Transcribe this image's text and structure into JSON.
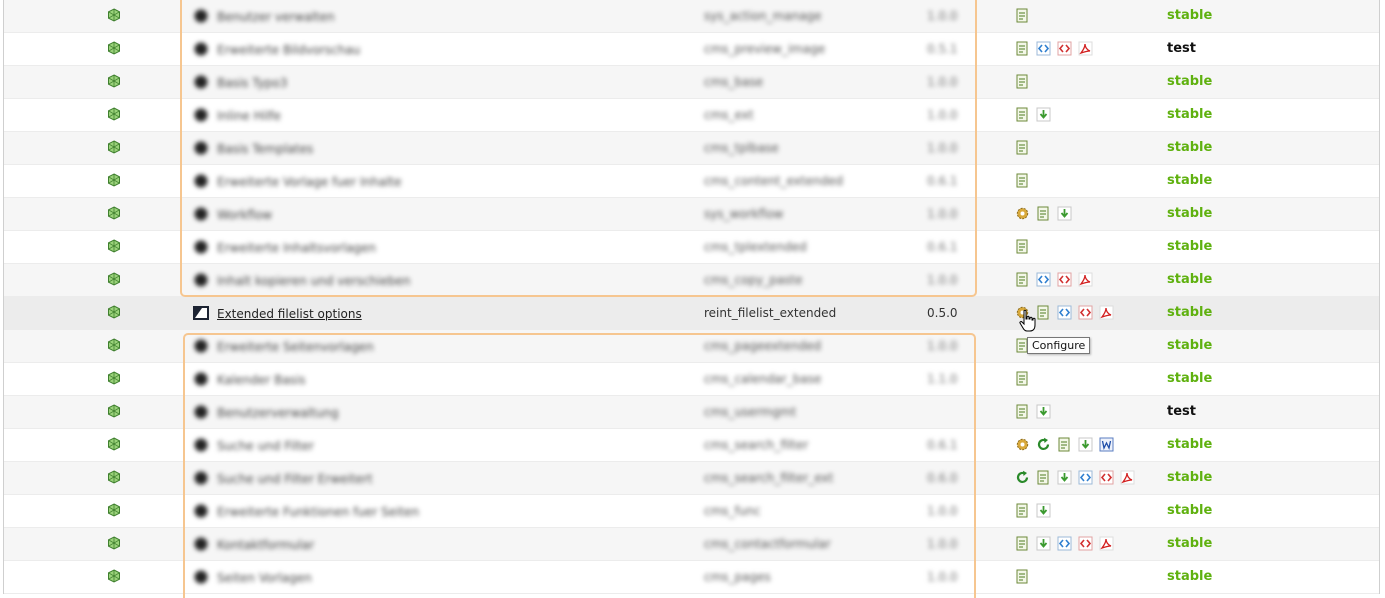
{
  "colors": {
    "stable": "#5fb10f",
    "test": "#111111",
    "highlight_border": "#f6c690"
  },
  "rows": [
    {
      "title": "Benutzer verwalten",
      "key": "sys_action_manage",
      "version": "1.0.0",
      "state": "stable",
      "state_class": "stable",
      "actions": [
        "doc-icon"
      ],
      "blurred": true
    },
    {
      "title": "Erweiterte Bildvorschau",
      "key": "cms_preview_image",
      "version": "0.5.1",
      "state": "test",
      "state_class": "test",
      "actions": [
        "doc-icon",
        "code-blue-icon",
        "code-red-icon",
        "pdf-icon"
      ],
      "blurred": true
    },
    {
      "title": "Basis Typo3",
      "key": "cms_base",
      "version": "1.0.0",
      "state": "stable",
      "state_class": "stable",
      "actions": [
        "doc-icon"
      ],
      "blurred": true
    },
    {
      "title": "Inline Hilfe",
      "key": "cms_ext",
      "version": "1.0.0",
      "state": "stable",
      "state_class": "stable",
      "actions": [
        "doc-icon",
        "download-icon"
      ],
      "blurred": true
    },
    {
      "title": "Basis Templates",
      "key": "cms_tplbase",
      "version": "1.0.0",
      "state": "stable",
      "state_class": "stable",
      "actions": [
        "doc-icon"
      ],
      "blurred": true
    },
    {
      "title": "Erweiterte Vorlage fuer Inhalte",
      "key": "cms_content_extended",
      "version": "0.6.1",
      "state": "stable",
      "state_class": "stable",
      "actions": [
        "doc-icon"
      ],
      "blurred": true
    },
    {
      "title": "Workflow",
      "key": "sys_workflow",
      "version": "1.0.0",
      "state": "stable",
      "state_class": "stable",
      "actions": [
        "gear-icon",
        "doc-icon",
        "download-icon"
      ],
      "blurred": true
    },
    {
      "title": "Erweiterte Inhaltsvorlagen",
      "key": "cms_tplextended",
      "version": "0.6.1",
      "state": "stable",
      "state_class": "stable",
      "actions": [
        "doc-icon"
      ],
      "blurred": true
    },
    {
      "title": "Inhalt kopieren und verschieben",
      "key": "cms_copy_paste",
      "version": "1.0.0",
      "state": "stable",
      "state_class": "stable",
      "actions": [
        "doc-icon",
        "code-blue-icon",
        "code-red-icon",
        "pdf-icon"
      ],
      "blurred": true
    },
    {
      "title": "Extended filelist options",
      "key": "reint_filelist_extended",
      "version": "0.5.0",
      "state": "stable",
      "state_class": "stable",
      "actions": [
        "gear-icon",
        "doc-icon",
        "code-blue-icon",
        "code-red-icon",
        "pdf-icon"
      ],
      "blurred": false,
      "active": true
    },
    {
      "title": "Erweiterte Seitenvorlagen",
      "key": "cms_pageextended",
      "version": "1.0.0",
      "state": "stable",
      "state_class": "stable",
      "actions": [
        "doc-icon"
      ],
      "blurred": true
    },
    {
      "title": "Kalender Basis",
      "key": "cms_calendar_base",
      "version": "1.1.0",
      "state": "stable",
      "state_class": "stable",
      "actions": [
        "doc-icon"
      ],
      "blurred": true
    },
    {
      "title": "Benutzerverwaltung",
      "key": "cms_usermgmt",
      "version": "",
      "state": "test",
      "state_class": "test",
      "actions": [
        "doc-icon",
        "download-icon"
      ],
      "blurred": true
    },
    {
      "title": "Suche und Filter",
      "key": "cms_search_filter",
      "version": "0.6.1",
      "state": "stable",
      "state_class": "stable",
      "actions": [
        "gear-icon",
        "refresh-icon",
        "doc-icon",
        "download-icon",
        "word-icon"
      ],
      "blurred": true
    },
    {
      "title": "Suche und Filter Erweitert",
      "key": "cms_search_filter_ext",
      "version": "0.6.0",
      "state": "stable",
      "state_class": "stable",
      "actions": [
        "refresh-icon",
        "doc-icon",
        "download-icon",
        "code-blue-icon",
        "code-red-icon",
        "pdf-icon"
      ],
      "blurred": true
    },
    {
      "title": "Erweiterte Funktionen fuer Seiten",
      "key": "cms_func",
      "version": "1.0.0",
      "state": "stable",
      "state_class": "stable",
      "actions": [
        "doc-icon",
        "download-icon"
      ],
      "blurred": true
    },
    {
      "title": "Kontaktformular",
      "key": "cms_contactformular",
      "version": "1.0.0",
      "state": "stable",
      "state_class": "stable",
      "actions": [
        "doc-icon",
        "download-icon",
        "code-blue-icon",
        "code-red-icon",
        "pdf-icon"
      ],
      "blurred": true
    },
    {
      "title": "Seiten Vorlagen",
      "key": "cms_pages",
      "version": "1.0.0",
      "state": "stable",
      "state_class": "stable",
      "actions": [
        "doc-icon"
      ],
      "blurred": true
    }
  ],
  "tooltip": {
    "text": "Configure"
  }
}
